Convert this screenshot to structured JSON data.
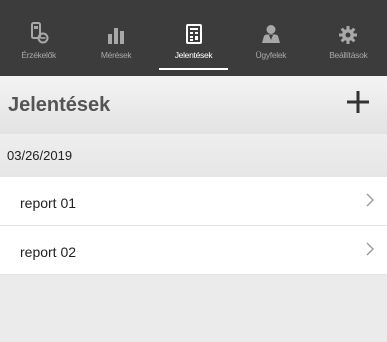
{
  "nav": {
    "items": [
      {
        "label": "Érzékelők",
        "icon": "sensor-icon",
        "active": false
      },
      {
        "label": "Mérések",
        "icon": "bar-chart-icon",
        "active": false
      },
      {
        "label": "Jelentések",
        "icon": "report-icon",
        "active": true
      },
      {
        "label": "Ügyfelek",
        "icon": "user-icon",
        "active": false
      },
      {
        "label": "Beállítások",
        "icon": "gear-icon",
        "active": false
      }
    ]
  },
  "header": {
    "title": "Jelentések",
    "add_icon": "plus-icon"
  },
  "section": {
    "date": "03/26/2019"
  },
  "reports": [
    {
      "label": "report 01",
      "icon": "chevron-right-icon"
    },
    {
      "label": "report 02",
      "icon": "chevron-right-icon"
    }
  ],
  "colors": {
    "nav_background": "#3c3c3c",
    "nav_inactive": "#a8a8a8",
    "nav_active": "#ffffff",
    "page_background": "#ebebeb"
  }
}
